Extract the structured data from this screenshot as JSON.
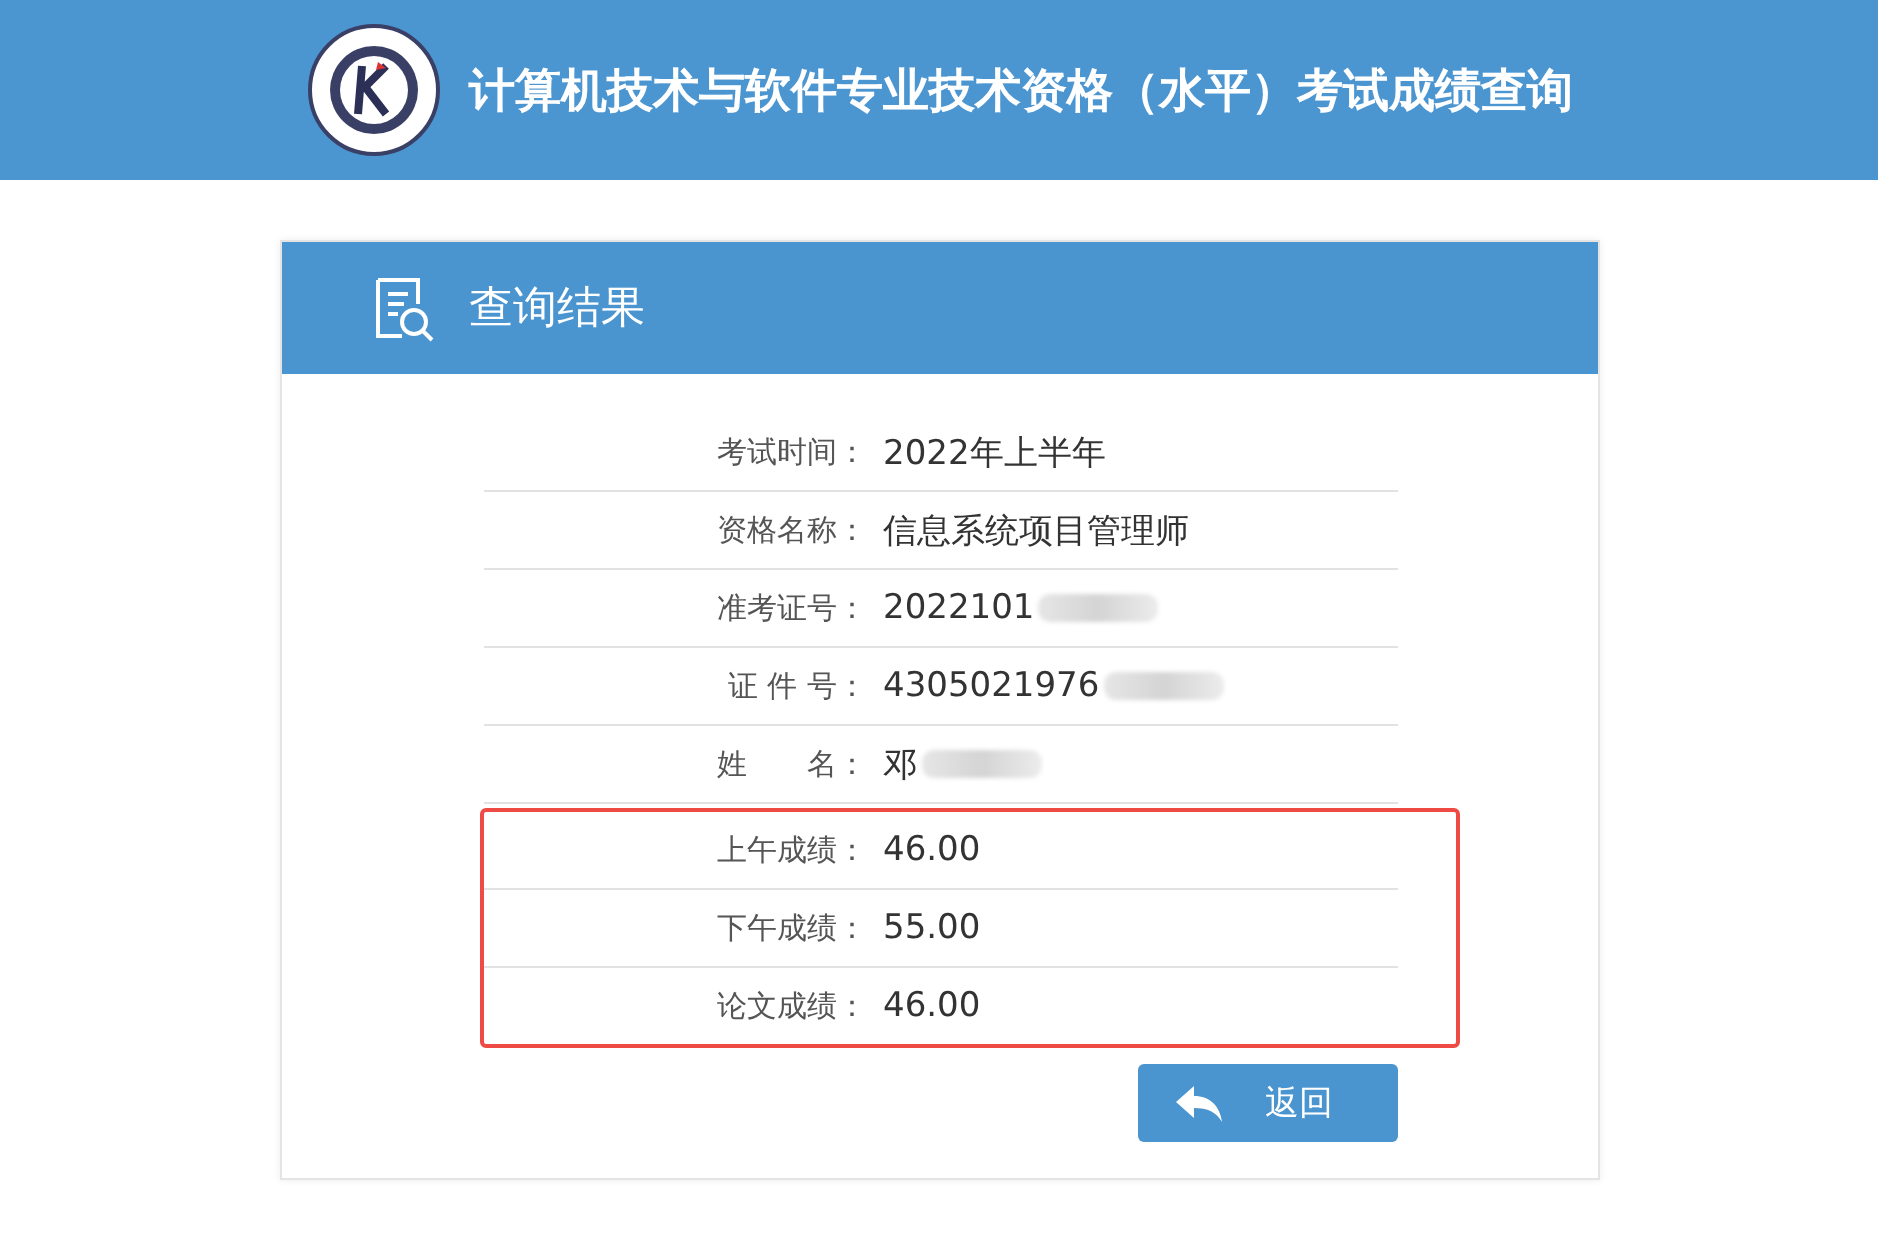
{
  "header": {
    "title": "计算机技术与软件专业技术资格（水平）考试成绩查询"
  },
  "card": {
    "title": "查询结果"
  },
  "rows": [
    {
      "label": "考试时间：",
      "value": "2022年上半年",
      "redacted": false,
      "highlighted": false
    },
    {
      "label": "资格名称：",
      "value": "信息系统项目管理师",
      "redacted": false,
      "highlighted": false
    },
    {
      "label": "准考证号：",
      "value": "2022101",
      "redacted": true,
      "highlighted": false
    },
    {
      "label": "证 件 号：",
      "value": "4305021976",
      "redacted": true,
      "highlighted": false
    },
    {
      "label": "姓　　名：",
      "value": "邓",
      "redacted": true,
      "highlighted": false
    },
    {
      "label": "上午成绩：",
      "value": "46.00",
      "redacted": false,
      "highlighted": true
    },
    {
      "label": "下午成绩：",
      "value": "55.00",
      "redacted": false,
      "highlighted": true
    },
    {
      "label": "论文成绩：",
      "value": "46.00",
      "redacted": false,
      "highlighted": true
    }
  ],
  "back_button": {
    "label": "返回"
  }
}
